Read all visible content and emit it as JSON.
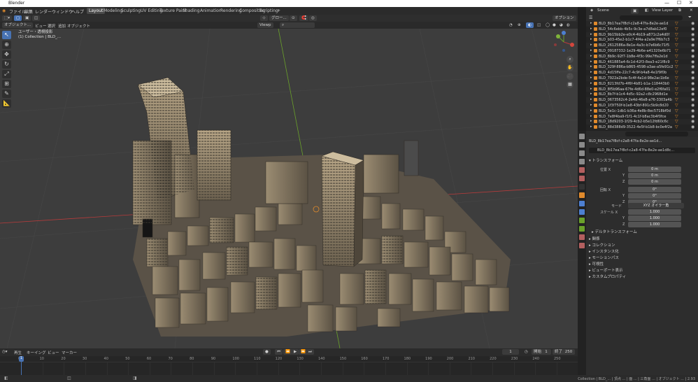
{
  "window": {
    "title": "Blender",
    "controls": [
      "—",
      "☐",
      "✕"
    ]
  },
  "menu": {
    "file": "ファイル",
    "edit": "編集",
    "render": "レンダー",
    "window": "ウィンドウ",
    "help": "ヘルプ",
    "workspaces": [
      "Layout",
      "Modeling",
      "Sculpting",
      "UV Editing",
      "Texture Paint",
      "Shading",
      "Animation",
      "Rendering",
      "Compositing",
      "Scripting"
    ],
    "scene_label": "Scene",
    "viewlayer_label": "View Layer"
  },
  "viewport_header": {
    "mode": "オブジェクト...",
    "view": "ビュー",
    "select": "選択",
    "add": "追加",
    "object": "オブジェクト",
    "orientation": "グロー...",
    "options": "オプション"
  },
  "viewport_header2": {
    "overlay_mode": "Viewp"
  },
  "viewport_info": {
    "line1": "ユーザー・透視投影",
    "line2": "(1) Collection | BLD_..."
  },
  "timeline": {
    "menus": [
      "再生",
      "キーイング",
      "ビュー",
      "マーカー"
    ],
    "current_frame": "1",
    "start_label": "開始",
    "start": "1",
    "end_label": "終了",
    "end": "250",
    "frame_ticks": [
      "0",
      "10",
      "20",
      "30",
      "40",
      "50",
      "60",
      "70",
      "80",
      "90",
      "100",
      "110",
      "120",
      "130",
      "140",
      "150",
      "160",
      "170",
      "180",
      "190",
      "200",
      "210",
      "220",
      "230",
      "240",
      "250"
    ],
    "playhead": "1"
  },
  "statusbar": {
    "text": "Collection | BLD_... | 頂点 ... | 面 ... | 三角面 ... | オブジェクト ... | 2.93"
  },
  "outliner": {
    "search_placeholder": "",
    "items": [
      "BLD_8b17ea7f8cf-c2a8-47fa-8e2e-ae1d",
      "BLD_54c6ebb-4b5c-9c3e-a7d8ab12ef0",
      "BLD_9b15bb2e-e0c4-4b19-a871c2a4d0f",
      "BLD_b03-45e2-b1c7-4f4a-a2a9e7f6b7c3",
      "BLD_2612586a-8e1e-4a3c-b7e6b6c71f5",
      "BLD_09187332-1e29-4b6e-a41320e6b71",
      "BLD_8b9c-92f7-1b8e-4f3c-99e7ffa2e1d",
      "BLD_461885a4-6c1d-42f3-8ea3-e21f8c9",
      "BLD_329f-886a-b865-4598-a3ae-a5fe91c2",
      "BLD_4d15ffe-22c7-4c9f-b4a8-4e1f9f0b",
      "BLD_7922a2bde-5c4f-4a1d-98e2ac1b6e",
      "BLD_8213fd7b-4f6f-4b81-b1a-118443b0",
      "BLD_8f5b96aa-67fe-4d6d-88e0-e2f6fa01",
      "BLD_8b7f-b1c4-4d5c-92a2-c8c2968d1e",
      "BLD_0673562c4-2e4d-46e8-a76-3303a4b",
      "BLD_1f3f750f-b1e8-43bf-891c5b9c8d20",
      "BLD_5e1c-1db1-b36a-4e8b-8ec5718bf0d",
      "BLD_7e8f4ba9-f1f1-4c1f-b8ac3b4f0fce",
      "BLD_18d9203-1f29-4cb2-b5e12fd60c6c",
      "BLD_88d388d9-3522-4e5f-b1b8-bc0e4f2a"
    ]
  },
  "properties": {
    "object_name": "BLD_8b17ea7f8cf-c2a8-47fa-8e2e-ae1d...",
    "object_name2": "BLD_8b17ea7f8cf-c2a8-47fa-8e2e-ae1d8c...",
    "transform_section": "トランスフォーム",
    "location_label": "位置 X",
    "location": [
      "0 m",
      "0 m",
      "0 m"
    ],
    "rotation_label": "回転 X",
    "rotation": [
      "0°",
      "0°",
      "0°"
    ],
    "mode_label": "モード",
    "mode_value": "XYZ オイラー角",
    "scale_label": "スケール X",
    "scale": [
      "1.000",
      "1.000",
      "1.000"
    ],
    "delta_section": "デルタトランスフォーム",
    "sections": [
      "関係",
      "コレクション",
      "インスタンス化",
      "モーションパス",
      "可視性",
      "ビューポート表示",
      "カスタムプロパティ"
    ],
    "y_label": "Y",
    "z_label": "Z"
  },
  "colors": {
    "accent": "#4772b3",
    "grid_red": "#b83b3b",
    "grid_green": "#6aa12a",
    "object_orange": "#e08a2c"
  }
}
